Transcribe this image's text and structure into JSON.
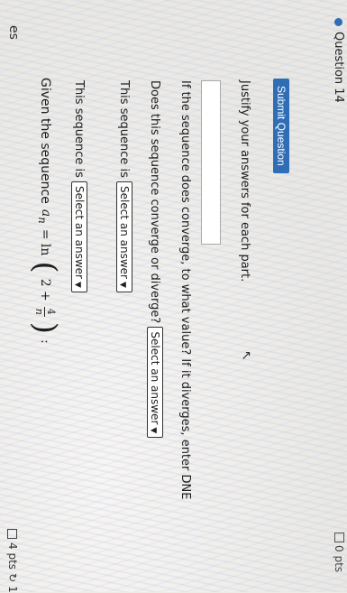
{
  "top_right": {
    "points": "0 pts"
  },
  "left_fragment": "es",
  "question": {
    "prompt_prefix": "Given the sequence",
    "var": "a",
    "sub": "n",
    "eq": "= ln",
    "two_plus": "2 +",
    "frac_num": "4",
    "frac_den": "n",
    "colon": ":"
  },
  "part1": {
    "text": "This sequence is",
    "select": "Select an answer"
  },
  "part2": {
    "text": "This sequence is",
    "select": "Select an answer"
  },
  "part3": {
    "text": "Does this sequence converge or diverge?",
    "select": "Select an answer"
  },
  "part4": {
    "text": "If the sequence does converge, to what value? If it diverges, enter DNE",
    "answer_value": ""
  },
  "part5": {
    "text": "Justify your answers for each part."
  },
  "submit_label": "Submit Question",
  "next_question": "Question 14",
  "footer": {
    "points": "4 pts",
    "retry": "1"
  }
}
